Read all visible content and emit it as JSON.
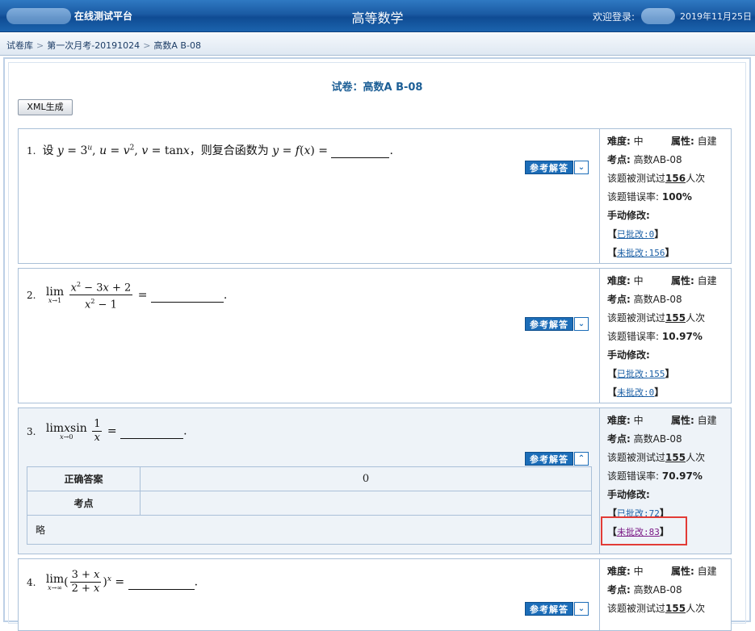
{
  "header": {
    "platform_name": "在线测试平台",
    "page_title": "高等数学",
    "welcome_label": "欢迎登录:",
    "date": "2019年11月25日"
  },
  "breadcrumb": [
    "试卷库",
    "第一次月考-20191024",
    "高数A B-08"
  ],
  "exam": {
    "title": "试卷：高数A B-08",
    "xml_button": "XML生成"
  },
  "labels": {
    "difficulty": "难度:",
    "attribute": "属性:",
    "topic": "考点:",
    "tested_prefix": "该题被测试过",
    "tested_suffix": "人次",
    "error_rate": "该题错误率:",
    "manual_edit": "手动修改:",
    "graded": "已批改:",
    "ungraded": "未批改:",
    "ref_answer": "参考解答",
    "bracket_open": "【",
    "bracket_close": "】"
  },
  "questions": [
    {
      "number": "1.",
      "difficulty": "中",
      "attribute": "自建",
      "topic": "高数AB-08",
      "tested": "156",
      "error_rate": "100%",
      "graded": "0",
      "ungraded": "156",
      "expanded": false
    },
    {
      "number": "2.",
      "difficulty": "中",
      "attribute": "自建",
      "topic": "高数AB-08",
      "tested": "155",
      "error_rate": "10.97%",
      "graded": "155",
      "ungraded": "0",
      "expanded": false
    },
    {
      "number": "3.",
      "difficulty": "中",
      "attribute": "自建",
      "topic": "高数AB-08",
      "tested": "155",
      "error_rate": "70.97%",
      "graded": "72",
      "ungraded": "83",
      "expanded": true,
      "answer_label": "正确答案",
      "answer_value": "0",
      "topic_label": "考点",
      "topic_detail": "略"
    },
    {
      "number": "4.",
      "difficulty": "中",
      "attribute": "自建",
      "topic": "高数AB-08",
      "tested": "155",
      "expanded": false
    }
  ],
  "math": {
    "q1_prefix": "设",
    "q1_mid": "，则复合函数为",
    "q1_end": ".",
    "q2_end": ".",
    "q3_end": ".",
    "q4_end": "."
  },
  "icons": {
    "expand": "chevron-down-icon",
    "collapse": "chevron-up-icon"
  },
  "colors": {
    "header": "#1a5aa3",
    "accent_blue": "#1c6db8",
    "highlight_box": "#e23b36"
  }
}
